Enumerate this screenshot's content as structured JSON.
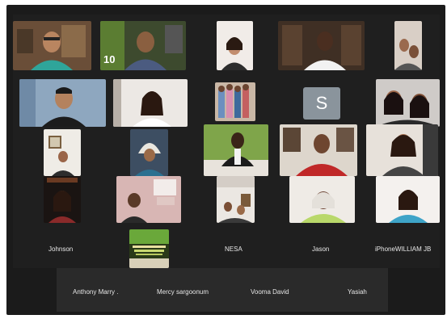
{
  "participants": {
    "johnson": "Johnson",
    "nesa": "NESA",
    "jason": "Jason",
    "iphone_william": "iPhoneWILLIAM JB",
    "avatar_letter": "S",
    "number_badge": "10"
  },
  "footer": {
    "names": [
      "Anthony Marry .",
      "Mercy sargoonum",
      "Vooma David",
      "Yasiah"
    ]
  },
  "colors": {
    "background": "#1b1b1b",
    "footer": "#2a2a2a",
    "avatar": "#8a949c"
  }
}
